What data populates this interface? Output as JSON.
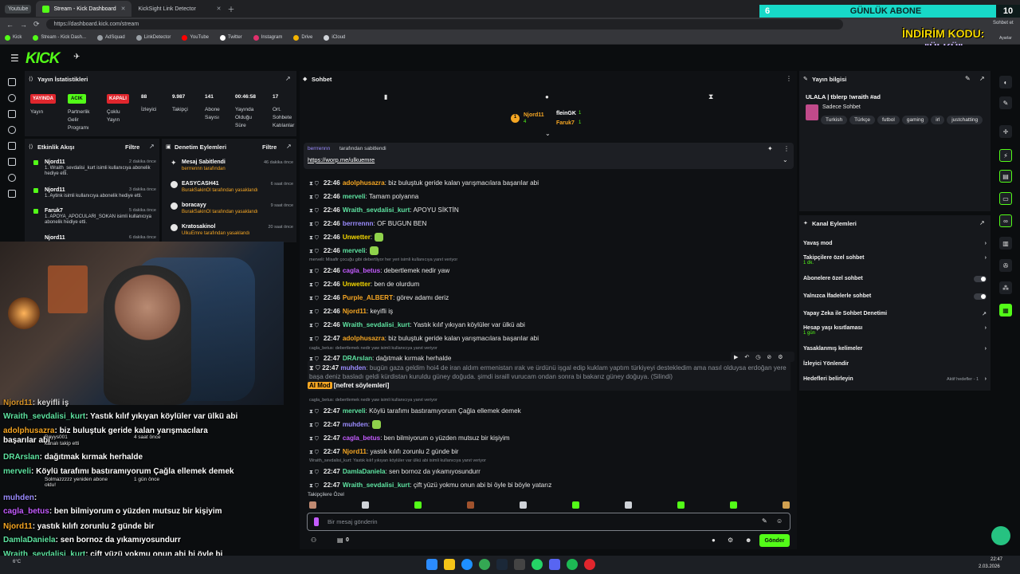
{
  "browser": {
    "yt_button": "Youtube",
    "tabs": [
      {
        "label": "Stream - Kick Dashboard"
      },
      {
        "label": "KickSight Link Detector"
      }
    ],
    "url": "https://dashboard.kick.com/stream",
    "bookmarks": [
      "Kick",
      "Stream - Kick Dash...",
      "AdSquad",
      "LinkDetector",
      "YouTube",
      "Twitter",
      "Instagram",
      "Drive",
      "iCloud"
    ],
    "profile": "Sohbet et",
    "profile2": "Ayarlar"
  },
  "overlay": {
    "abone_label": "GÜNLÜK ABONE",
    "abone_left": "6",
    "abone_count": "10",
    "indirim": "İNDİRİM KODU:",
    "ulku": "\"ÜLKÜ\""
  },
  "stats": {
    "title": "Yayın İstatistikleri",
    "items": [
      {
        "value_badge": "YAYINDA",
        "label": "Yayın"
      },
      {
        "value_badge": "ACIK",
        "label": "Partnerlik Gelir Programı"
      },
      {
        "value_badge": "KAPALI",
        "label": "Çoklu Yayın"
      },
      {
        "value": "88",
        "label": "İzleyici"
      },
      {
        "value": "9.987",
        "label": "Takipçi"
      },
      {
        "value": "141",
        "label": "Abone Sayısı"
      },
      {
        "value": "00:46:58",
        "label": "Yayında Olduğu Süre"
      },
      {
        "value": "17",
        "label": "Ort. Sohbete Katılanlar"
      }
    ]
  },
  "activity": {
    "title": "Etkinlik Akışı",
    "filter": "Filtre",
    "items": [
      {
        "name": "Njord11",
        "time": "2 dakika önce",
        "desc": "1. Wraith_sevdalisi_kurt isimli kullanıcıya abonelik hediye etti."
      },
      {
        "name": "Njord11",
        "time": "3 dakika önce",
        "desc": "1. Aytink isimli kullanıcıya abonelik hediye etti."
      },
      {
        "name": "Faruk7",
        "time": "5 dakika önce",
        "desc": "1. APOYA_APOCULARI_SOKAN isimli kullanıcıya abonelik hediye etti."
      },
      {
        "name": "Njord11",
        "time": "6 dakika önce",
        "desc": ""
      }
    ]
  },
  "moderation": {
    "title": "Denetim Eylemleri",
    "filter": "Filtre",
    "items": [
      {
        "name": "Mesaj Sabitlendi",
        "time": "46 dakika önce",
        "desc": "berrrennn tarafından"
      },
      {
        "name": "EASYCASH41",
        "time": "6 saat önce",
        "desc": "BurakSakinOl tarafından yasaklandı"
      },
      {
        "name": "boracayy",
        "time": "9 saat önce",
        "desc": "BurakSakinOl tarafından yasaklandı"
      },
      {
        "name": "Kratosakinol",
        "time": "20 saat önce",
        "desc": "UlkuEmre tarafından yasaklandı"
      }
    ]
  },
  "overlay_chat": [
    {
      "name": "Njord11",
      "text": ": keyifli iş"
    },
    {
      "name": "Wraith_sevdalisi_kurt",
      "text": ": Yastık kılıf yıkıyan köylüler var ülkü abi"
    },
    {
      "name": "adolphusazra",
      "text": ": biz buluştuk geride kalan yarışmacılara başarılar abi"
    },
    {
      "name": "DRArslan",
      "text": ": dağıtmak kırmak herhalde"
    },
    {
      "name": "merveli",
      "text": ": Köylü tarafımı bastıramıyorum Çağla  ellemek demek"
    },
    {
      "name": "muhden",
      "text": ":"
    },
    {
      "name": "cagla_betus",
      "text": ": ben bilmiyorum o yüzden mutsuz bir kişiyim"
    },
    {
      "name": "Njord11",
      "text": ": yastık kılıfı zorunlu 2 günde bir"
    },
    {
      "name": "DamlaDaniela",
      "text": ": sen bornoz da yıkamıyosundurr"
    },
    {
      "name": "Wraith_sevdalisi_kurt",
      "text": ": çift yüzü yokmu onun abi bi öyle bi böyle yatarız"
    }
  ],
  "overlay_events": [
    {
      "text": "Rayys001",
      "sub": "kanalı takip etti"
    },
    {
      "text": "Solmazzzzz yeniden abone oldu!",
      "sub": ""
    },
    {
      "text": "4 saat önce",
      "sub": ""
    },
    {
      "text": "1 gün önce",
      "sub": ""
    }
  ],
  "chat": {
    "title": "Sohbet",
    "top_users": [
      {
        "name": "Njord11",
        "count": "4"
      },
      {
        "name": "fleinGK",
        "count": "1"
      },
      {
        "name": "Faruk7",
        "count": "1"
      }
    ],
    "pinned": {
      "by": "berrrennn",
      "by_suffix": "tarafından sabitlendi",
      "link": "https://worp.me/ulkuemre"
    },
    "messages": [
      {
        "time": "22:46",
        "user": "adolphusazra",
        "color": "#f5a623",
        "text": ": biz buluştuk geride kalan yarışmacılara başarılar abi"
      },
      {
        "time": "22:46",
        "user": "merveli",
        "color": "#5ee3a1",
        "text": ": Tamam polyanna"
      },
      {
        "time": "22:46",
        "user": "Wraith_sevdalisi_kurt",
        "color": "#5ee3a1",
        "text": ": APOYU SİKTİN"
      },
      {
        "time": "22:46",
        "user": "berrrennn",
        "color": "#9b8cff",
        "text": ": OF BUGUN BEN"
      },
      {
        "time": "22:46",
        "user": "Unwetter",
        "color": "#f5d800",
        "text": ":"
      },
      {
        "time": "22:46",
        "user": "merveli",
        "color": "#5ee3a1",
        "text": ":"
      },
      {
        "time": "22:46",
        "user": "cagla_betus",
        "color": "#c45cff",
        "text": ": debertlemek nedir yaw",
        "reply": "merveli: Misafir çocuğu gibi debertliyor her yeri isimli kullanıcıya yanıt veriyor"
      },
      {
        "time": "22:46",
        "user": "Unwetter",
        "color": "#f5d800",
        "text": ": ben de olurdum"
      },
      {
        "time": "22:46",
        "user": "Purple_ALBERT",
        "color": "#f5a623",
        "text": ": görev adamı deriz"
      },
      {
        "time": "22:46",
        "user": "Njord11",
        "color": "#f5a623",
        "text": ": keyifli iş"
      },
      {
        "time": "22:46",
        "user": "Wraith_sevdalisi_kurt",
        "color": "#5ee3a1",
        "text": ": Yastık kılıf yıkıyan köylüler var ülkü abi"
      },
      {
        "time": "22:47",
        "user": "adolphusazra",
        "color": "#f5a623",
        "text": ": biz buluştuk geride kalan yarışmacılara başarılar abi"
      },
      {
        "time": "22:47",
        "user": "DRArslan",
        "color": "#5ee3a1",
        "text": ": dağıtmak kırmak herhalde",
        "reply": "cagla_betus: debertlemek nedir yaw isimli kullanıcıya yanıt veriyor"
      },
      {
        "time": "22:47",
        "user": "merveli",
        "color": "#5ee3a1",
        "text": ": Köylü tarafımı bastıramıyorum Çağla  ellemek demek",
        "reply": "cagla_betus: debertlemek nedir yaw isimli kullanıcıya yanıt veriyor"
      },
      {
        "time": "22:47",
        "user": "muhden",
        "color": "#9b8cff",
        "text": ":"
      },
      {
        "time": "22:47",
        "user": "cagla_betus",
        "color": "#c45cff",
        "text": ": ben bilmiyorum o yüzden mutsuz bir kişiyim"
      },
      {
        "time": "22:47",
        "user": "Njord11",
        "color": "#f5a623",
        "text": ": yastık kılıfı zorunlu 2 günde bir"
      },
      {
        "time": "22:47",
        "user": "DamlaDaniela",
        "color": "#5ee3a1",
        "text": ": sen bornoz da yıkamıyosundurr",
        "reply": "Wraith_sevdalisi_kurt: Yastık kılıf yıkıyan köylüler var ülkü abi isimli kullanıcıya yanıt veriyor"
      },
      {
        "time": "22:47",
        "user": "Wraith_sevdalisi_kurt",
        "color": "#5ee3a1",
        "text": ": çift yüzü yokmu onun abi bi öyle bi böyle yatarız"
      }
    ],
    "deleted": {
      "time": "22:47",
      "user": "muhden",
      "text": ": bugün gaza geldim hoi4 de iran aldım ermenistan ırak ve ürdünü işgal edip kuklam yaptım türkiyeyi destekledim ama nasıl olduysa erdoğan yere başa deniz basladı geldi kürdistan kuruldu güney doğuda. şimdi israill vurucam ondan sonra bi bakarız güney doğuya. (Silindi)",
      "ai_mod": "AI Mod",
      "reason": "[nefret söylemleri]"
    },
    "followers_only": "Takipçilere Özel",
    "input_placeholder": "Bir mesaj gönderin",
    "send": "Gönder",
    "left_count": "0"
  },
  "stream_info": {
    "title": "Yayın bilgisi",
    "stream_title": "ULALA | tblerp !wraith #ad",
    "category": "Sadece Sohbet",
    "tags": [
      "Turkish",
      "Türkçe",
      "futbol",
      "gaming",
      "irl",
      "justchatting"
    ]
  },
  "channel_actions": {
    "title": "Kanal Eylemleri",
    "items": [
      {
        "label": "Yavaş mod",
        "sub": "",
        "kind": "arrow"
      },
      {
        "label": "Takipçilere özel sohbet",
        "sub": "1 dk.",
        "kind": "arrow"
      },
      {
        "label": "Abonelere özel sohbet",
        "sub": "",
        "kind": "toggle"
      },
      {
        "label": "Yalnızca İfadelerle sohbet",
        "sub": "",
        "kind": "toggle"
      },
      {
        "label": "Yapay Zeka ile Sohbet Denetimi",
        "sub": "",
        "kind": "link"
      },
      {
        "label": "Hesap yaşı kısıtlaması",
        "sub": "1 gün",
        "kind": "arrow"
      },
      {
        "label": "Yasaklanmış kelimeler",
        "sub": "",
        "kind": "arrow"
      },
      {
        "label": "İzleyici Yönlendir",
        "sub": "",
        "kind": "none"
      },
      {
        "label": "Hedefleri belirleyin",
        "sub": "Aktif hedefler - 1",
        "kind": "arrow"
      }
    ]
  },
  "taskbar": {
    "time": "22:47",
    "date": "2.03.2026",
    "weather": "6°C"
  }
}
